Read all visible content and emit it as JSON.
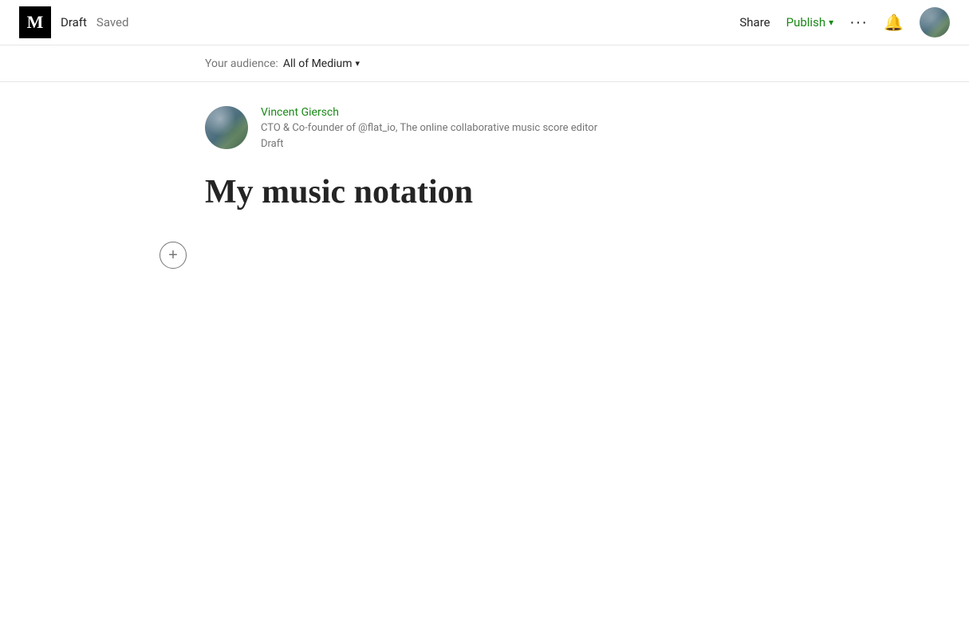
{
  "navbar": {
    "logo_letter": "M",
    "draft_label": "Draft",
    "saved_label": "Saved",
    "share_label": "Share",
    "publish_label": "Publish",
    "more_label": "···"
  },
  "audience": {
    "prefix": "Your audience:",
    "value": "All of Medium"
  },
  "author": {
    "name": "Vincent Giersch",
    "bio": "CTO & Co-founder of @flat_io, The online collaborative music score editor",
    "status": "Draft"
  },
  "article": {
    "title": "My music notation"
  },
  "plus_button": {
    "label": "+"
  }
}
